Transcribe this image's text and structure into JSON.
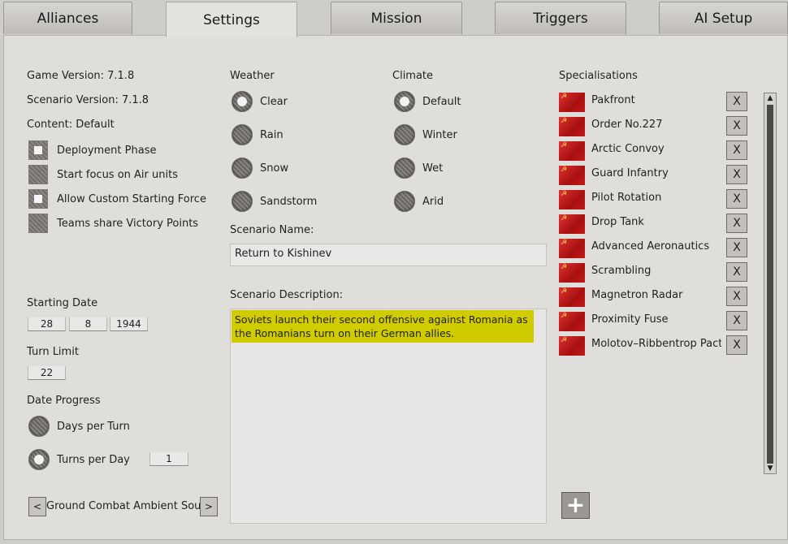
{
  "tabs": [
    {
      "label": "Alliances"
    },
    {
      "label": "Settings"
    },
    {
      "label": "Mission"
    },
    {
      "label": "Triggers"
    },
    {
      "label": "AI Setup"
    }
  ],
  "game_version": "Game Version: 7.1.8",
  "scenario_version": "Scenario Version: 7.1.8",
  "content": "Content: Default",
  "options": [
    {
      "label": "Deployment Phase",
      "checked": true
    },
    {
      "label": "Start focus on Air units",
      "checked": false
    },
    {
      "label": "Allow Custom Starting Force",
      "checked": true
    },
    {
      "label": "Teams share Victory Points",
      "checked": false
    }
  ],
  "starting_date": {
    "label": "Starting Date",
    "day": "28",
    "month": "8",
    "year": "1944"
  },
  "turn_limit": {
    "label": "Turn Limit",
    "value": "22"
  },
  "date_progress": {
    "label": "Date Progress",
    "days_label": "Days per Turn",
    "turns_label": "Turns per Day",
    "turns_value": "1"
  },
  "ambient": {
    "prev": "<",
    "label": "Ground Combat Ambient Sound",
    "next": ">"
  },
  "weather": {
    "label": "Weather",
    "options": [
      "Clear",
      "Rain",
      "Snow",
      "Sandstorm"
    ],
    "selected": "Clear"
  },
  "climate": {
    "label": "Climate",
    "options": [
      "Default",
      "Winter",
      "Wet",
      "Arid"
    ],
    "selected": "Default"
  },
  "scenario_name": {
    "label": "Scenario Name:",
    "value": "Return to Kishinev"
  },
  "scenario_description": {
    "label": "Scenario Description:",
    "value": "Soviets launch their second offensive against Romania as the Romanians turn on their German allies."
  },
  "specialisations": {
    "label": "Specialisations",
    "remove_label": "X",
    "add_label": "+",
    "items": [
      "Pakfront",
      "Order No.227",
      "Arctic Convoy",
      "Guard Infantry",
      "Pilot Rotation",
      "Drop Tank",
      "Advanced Aeronautics",
      "Scrambling",
      "Magnetron Radar",
      "Proximity Fuse",
      "Molotov–Ribbentrop Pact"
    ]
  },
  "scroll": {
    "up": "▲",
    "down": "▼"
  }
}
